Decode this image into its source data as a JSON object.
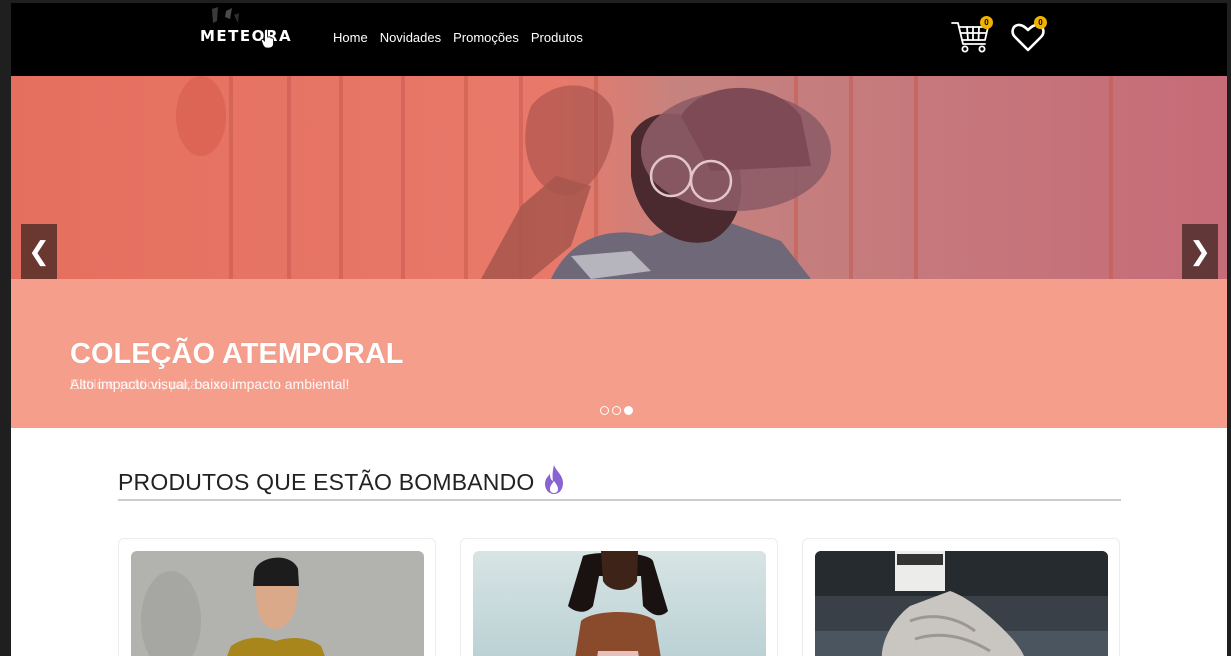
{
  "navbar": {
    "logo": "METEORA",
    "links": [
      "Home",
      "Novidades",
      "Promoções",
      "Produtos"
    ],
    "cart_count": "0",
    "wishlist_count": "0"
  },
  "hero": {
    "title": "COLEÇÃO ATEMPORAL",
    "subtitle": "Alto impacto visual, baixo impacto ambiental!",
    "subtitle_ghost": "Estilo e prático, para o seu",
    "prev_label": "❮",
    "next_label": "❯",
    "slide_count": 3,
    "active_slide": 3
  },
  "section": {
    "title": "PRODUTOS QUE ESTÃO BOMBANDO"
  },
  "colors": {
    "navbar_bg": "#000000",
    "hero_bg": "#f59e8c",
    "badge": "#f0b400",
    "fire_icon": "#8a63d2"
  },
  "icons": [
    "cart-icon",
    "heart-icon",
    "fire-icon",
    "chevron-left-icon",
    "chevron-right-icon"
  ]
}
